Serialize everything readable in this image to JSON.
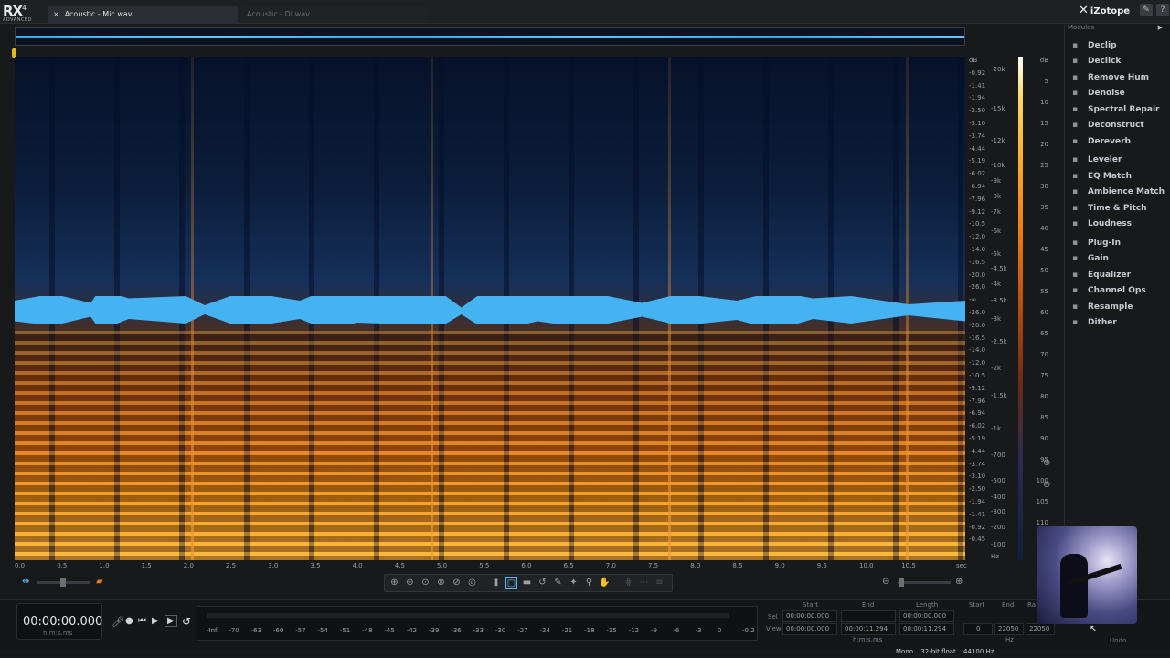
{
  "app": {
    "logo": "RX",
    "version": "4",
    "edition": "ADVANCED",
    "brand": "iZotope"
  },
  "tabs": [
    {
      "label": "Acoustic - Mic.wav",
      "active": true
    },
    {
      "label": "Acoustic - DI.wav",
      "active": false
    }
  ],
  "modules": {
    "header": "Modules",
    "items": [
      {
        "label": "Declip",
        "icon": "declip-icon"
      },
      {
        "label": "Declick",
        "icon": "declick-icon"
      },
      {
        "label": "Remove Hum",
        "icon": "hum-icon"
      },
      {
        "label": "Denoise",
        "icon": "denoise-icon"
      },
      {
        "label": "Spectral Repair",
        "icon": "spectral-repair-icon"
      },
      {
        "label": "Deconstruct",
        "icon": "deconstruct-icon"
      },
      {
        "label": "Dereverb",
        "icon": "dereverb-icon"
      },
      {
        "label": "Leveler",
        "icon": "leveler-icon"
      },
      {
        "label": "EQ Match",
        "icon": "eq-match-icon"
      },
      {
        "label": "Ambience Match",
        "icon": "ambience-icon"
      },
      {
        "label": "Time & Pitch",
        "icon": "time-pitch-icon"
      },
      {
        "label": "Loudness",
        "icon": "loudness-icon"
      },
      {
        "label": "Plug-In",
        "icon": "plugin-icon"
      },
      {
        "label": "Gain",
        "icon": "gain-icon"
      },
      {
        "label": "Equalizer",
        "icon": "equalizer-icon"
      },
      {
        "label": "Channel Ops",
        "icon": "channel-ops-icon"
      },
      {
        "label": "Resample",
        "icon": "resample-icon"
      },
      {
        "label": "Dither",
        "icon": "dither-icon"
      }
    ]
  },
  "waveform_db": [
    "dB",
    "-0.92",
    "-1.41",
    "-1.94",
    "-2.50",
    "-3.10",
    "-3.74",
    "-4.44",
    "-5.19",
    "-6.02",
    "-6.94",
    "-7.96",
    "-9.12",
    "-10.5",
    "-12.0",
    "-14.0",
    "-16.5",
    "-20.0",
    "-26.0",
    "-∞",
    "-26.0",
    "-20.0",
    "-16.5",
    "-14.0",
    "-12.0",
    "-10.5",
    "-9.12",
    "-7.96",
    "-6.94",
    "-6.02",
    "-5.19",
    "-4.44",
    "-3.74",
    "-3.10",
    "-2.50",
    "-1.94",
    "-1.41",
    "-0.92",
    "-0.45"
  ],
  "freq_labels": [
    "-20k",
    "-15k",
    "-12k",
    "-10k",
    "-9k",
    "-8k",
    "-7k",
    "-6k",
    "-5k",
    "-4.5k",
    "-4k",
    "-3.5k",
    "-3k",
    "-2.5k",
    "-2k",
    "-1.5k",
    "-1k",
    "-700",
    "-500",
    "-400",
    "-300",
    "-200",
    "-100",
    "Hz"
  ],
  "colorbar_labels": [
    "dB",
    "5",
    "10",
    "15",
    "20",
    "25",
    "30",
    "35",
    "40",
    "45",
    "50",
    "55",
    "60",
    "65",
    "70",
    "75",
    "80",
    "85",
    "90",
    "95",
    "100",
    "105",
    "110",
    "115"
  ],
  "time_labels": [
    "0.0",
    "0.5",
    "1.0",
    "1.5",
    "2.0",
    "2.5",
    "3.0",
    "3.5",
    "4.0",
    "4.5",
    "5.0",
    "5.5",
    "6.0",
    "6.5",
    "7.0",
    "7.5",
    "8.0",
    "8.5",
    "9.0",
    "9.5",
    "10.0",
    "10.5",
    "sec"
  ],
  "transport": {
    "timecode": "00:00:00.000",
    "format": "h:m:s.ms"
  },
  "meter_labels": [
    "-Inf.",
    "-70",
    "-63",
    "-60",
    "-57",
    "-54",
    "-51",
    "-48",
    "-45",
    "-42",
    "-39",
    "-36",
    "-33",
    "-30",
    "-27",
    "-24",
    "-21",
    "-18",
    "-15",
    "-12",
    "-9",
    "-6",
    "-3",
    "0",
    "-0.2"
  ],
  "selection": {
    "head_start": "Start",
    "head_end": "End",
    "head_length": "Length",
    "sel_label": "Sel",
    "view_label": "View",
    "sel_start": "00:00:00.000",
    "sel_end": "",
    "sel_length": "00:00:00.000",
    "view_start": "00:00:00.000",
    "view_end": "00:00:11.294",
    "view_length": "00:00:11.294",
    "format": "h:m:s.ms"
  },
  "range": {
    "head_start": "Start",
    "head_end": "End",
    "head_range": "Ra",
    "view_start": "0",
    "view_end": "22050",
    "view_range": "22050",
    "unit": "Hz"
  },
  "status": {
    "channels": "Mono",
    "bitdepth": "32-bit float",
    "samplerate": "44100 Hz"
  },
  "undo_label": "Undo"
}
